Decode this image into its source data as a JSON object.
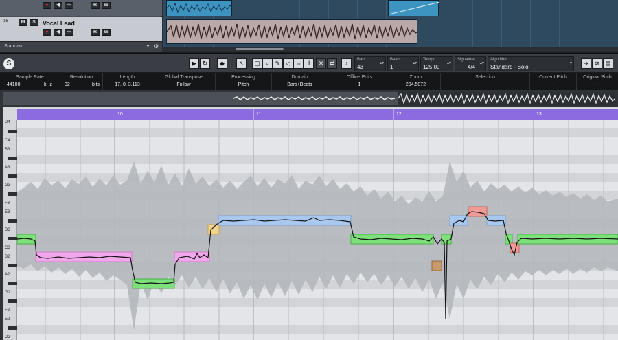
{
  "arrange": {
    "tracks": [
      {
        "number": "",
        "name": "",
        "buttons": [
          "●",
          "◀",
          "∞",
          "R",
          "W"
        ]
      },
      {
        "number": "16",
        "name": "Vocal Lead",
        "buttons": [
          "M",
          "S",
          "●",
          "◀",
          "∞",
          "R",
          "W"
        ]
      }
    ],
    "standard_label": "Standard"
  },
  "toolbar": {
    "bar": {
      "label": "Bars",
      "value": "43"
    },
    "beats": {
      "label": "Beats",
      "value": "1"
    },
    "tempo": {
      "label": "Tempo",
      "value": "125.00"
    },
    "signature": {
      "label": "Signature",
      "value": "4/4"
    },
    "algorithm": {
      "label": "Algorithm",
      "value": "Standard - Solo"
    }
  },
  "infoline": {
    "sample_rate": {
      "label": "Sample Rate",
      "value": "44100",
      "unit": "kHz"
    },
    "resolution": {
      "label": "Resolution",
      "value": "32",
      "unit": "bits"
    },
    "length": {
      "label": "Length",
      "value": "17. 0. 3.113"
    },
    "global_transpose": {
      "label": "Global Transpose",
      "value": "Follow"
    },
    "processing": {
      "label": "Processing",
      "value": "Pitch"
    },
    "domain": {
      "label": "Domain",
      "value": "Bars+Beats"
    },
    "offline_edits": {
      "label": "Offline Edits",
      "value": "1"
    },
    "zoom": {
      "label": "Zoom",
      "value": "204.5072"
    },
    "selection": {
      "label": "Selection",
      "value": "-"
    },
    "current_pitch": {
      "label": "Current Pitch",
      "value": "-"
    },
    "original_pitch": {
      "label": "Original Pitch",
      "value": "-"
    }
  },
  "ruler": {
    "bars": [
      "10",
      "11",
      "12",
      "13"
    ]
  },
  "keyboard": {
    "labels": [
      "D4",
      "C4",
      "B3",
      "A3",
      "G3",
      "F3",
      "E3",
      "D3",
      "C3",
      "B2",
      "A2",
      "G2",
      "F2",
      "E2",
      "D2"
    ]
  },
  "colors": {
    "ruler": "#8c6be0",
    "segment_green": "#7ee07a",
    "segment_pink": "#f1a8ea",
    "segment_blue": "#a9c8ef",
    "segment_yellow": "#f2d48a",
    "segment_red": "#ef9c96",
    "segment_brown": "#c69a6a"
  }
}
